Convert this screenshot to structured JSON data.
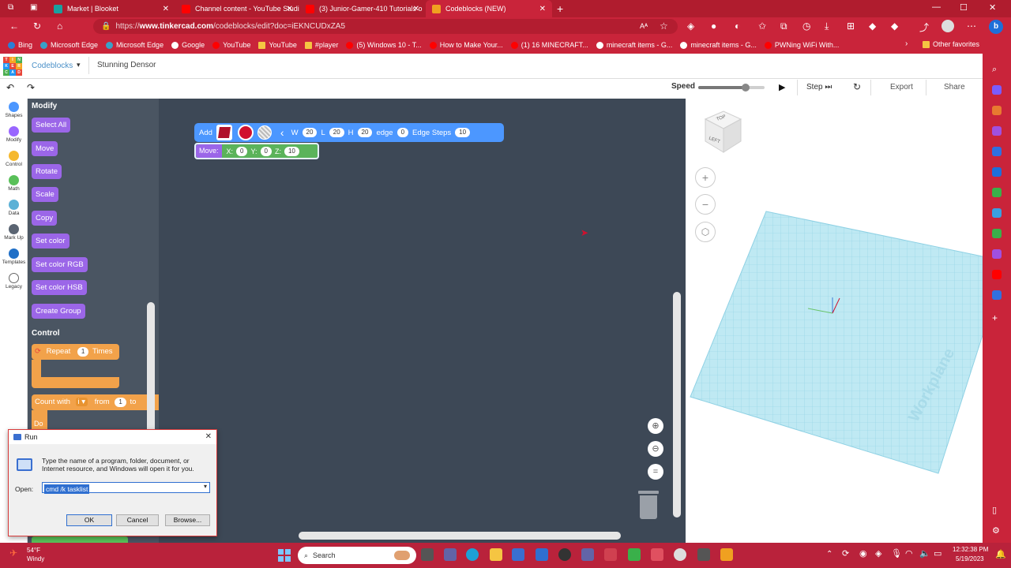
{
  "browser": {
    "tabs": [
      {
        "label": "Market | Blooket",
        "color": "#1aa0a0"
      },
      {
        "label": "Channel content - YouTube Studio",
        "color": "#ff0000"
      },
      {
        "label": "(3) Junior-Gamer-410 Tutorials o",
        "color": "#ff0000"
      },
      {
        "label": "Codeblocks (NEW)",
        "color": "#f0a020"
      }
    ],
    "new_tab_label": "+",
    "url_prefix": "https://",
    "url_host": "www.tinkercad.com",
    "url_path": "/codeblocks/edit?doc=iEKNCUDxZA5",
    "bookmarks": [
      {
        "label": "Bing",
        "color": "#2a7fd6"
      },
      {
        "label": "Microsoft Edge",
        "color": "#3aa0c8"
      },
      {
        "label": "Microsoft Edge",
        "color": "#3aa0c8"
      },
      {
        "label": "Google",
        "color": "#ffffff"
      },
      {
        "label": "YouTube",
        "color": "#ff0000"
      },
      {
        "label": "YouTube",
        "color": "#f5c542"
      },
      {
        "label": "#player",
        "color": "#f5c542"
      },
      {
        "label": "(5) Windows 10 - T...",
        "color": "#ff0000"
      },
      {
        "label": "How to Make Your...",
        "color": "#ff0000"
      },
      {
        "label": "(1) 16 MINECRAFT...",
        "color": "#ff0000"
      },
      {
        "label": "minecraft items - G...",
        "color": "#ffffff"
      },
      {
        "label": "minecraft items - G...",
        "color": "#ffffff"
      },
      {
        "label": "PWNing WiFi With...",
        "color": "#ff0000"
      }
    ],
    "other_favorites": "Other favorites"
  },
  "app": {
    "logo_letters": [
      "T",
      "I",
      "N",
      "K",
      "E",
      "R",
      "C",
      "A",
      "D"
    ],
    "logo_colors": [
      "#e8473b",
      "#f5a623",
      "#4caf50",
      "#2196f3",
      "#e8473b",
      "#f5a623",
      "#4caf50",
      "#2196f3",
      "#e8473b"
    ],
    "product": "Codeblocks",
    "design_name": "Stunning Densor",
    "speed_label": "Speed",
    "speed_value": 0.72,
    "step_label": "Step",
    "export_label": "Export",
    "share_label": "Share"
  },
  "categories": [
    {
      "label": "Shapes",
      "color": "#4c97ff"
    },
    {
      "label": "Modify",
      "color": "#9966ff"
    },
    {
      "label": "Control",
      "color": "#f5b82e"
    },
    {
      "label": "Math",
      "color": "#59c059"
    },
    {
      "label": "Data",
      "color": "#5cb1d6"
    },
    {
      "label": "Mark Up",
      "color": "#5a6472"
    },
    {
      "label": "Templates",
      "color": "#1f6fc7"
    },
    {
      "label": "Legacy",
      "color": "#ffffff"
    }
  ],
  "flyout": {
    "modify_title": "Modify",
    "modify_blocks": [
      "Select All",
      "Move",
      "Rotate",
      "Scale",
      "Copy",
      "Set color",
      "Set color RGB",
      "Set color HSB",
      "Create Group"
    ],
    "control_title": "Control",
    "repeat_label": "Repeat",
    "repeat_count": "1",
    "repeat_times": "Times",
    "count_with": "Count with",
    "count_var": "i",
    "count_from": "from",
    "count_from_val": "1",
    "count_to": "to",
    "do_label": "Do"
  },
  "workspace": {
    "add_label": "Add",
    "w_label": "W",
    "w_val": "20",
    "l_label": "L",
    "l_val": "20",
    "h_label": "H",
    "h_val": "20",
    "edge_label": "edge",
    "edge_val": "0",
    "edge_steps_label": "Edge Steps",
    "edge_steps_val": "10",
    "move_label": "Move:",
    "x_label": "X:",
    "x_val": "0",
    "y_label": "Y:",
    "y_val": "0",
    "z_label": "Z:",
    "z_val": "10"
  },
  "viewport": {
    "cube_top": "TOP",
    "cube_left": "LEFT",
    "workplane_label": "Workplane"
  },
  "run_dialog": {
    "title": "Run",
    "description": "Type the name of a program, folder, document, or Internet resource, and Windows will open it for you.",
    "open_label": "Open:",
    "command": "cmd /k tasklist",
    "ok_label": "OK",
    "cancel_label": "Cancel",
    "browse_label": "Browse..."
  },
  "taskbar": {
    "temp": "54°F",
    "weather": "Windy",
    "search_label": "Search",
    "time": "12:32:38 PM",
    "date": "5/19/2023"
  }
}
